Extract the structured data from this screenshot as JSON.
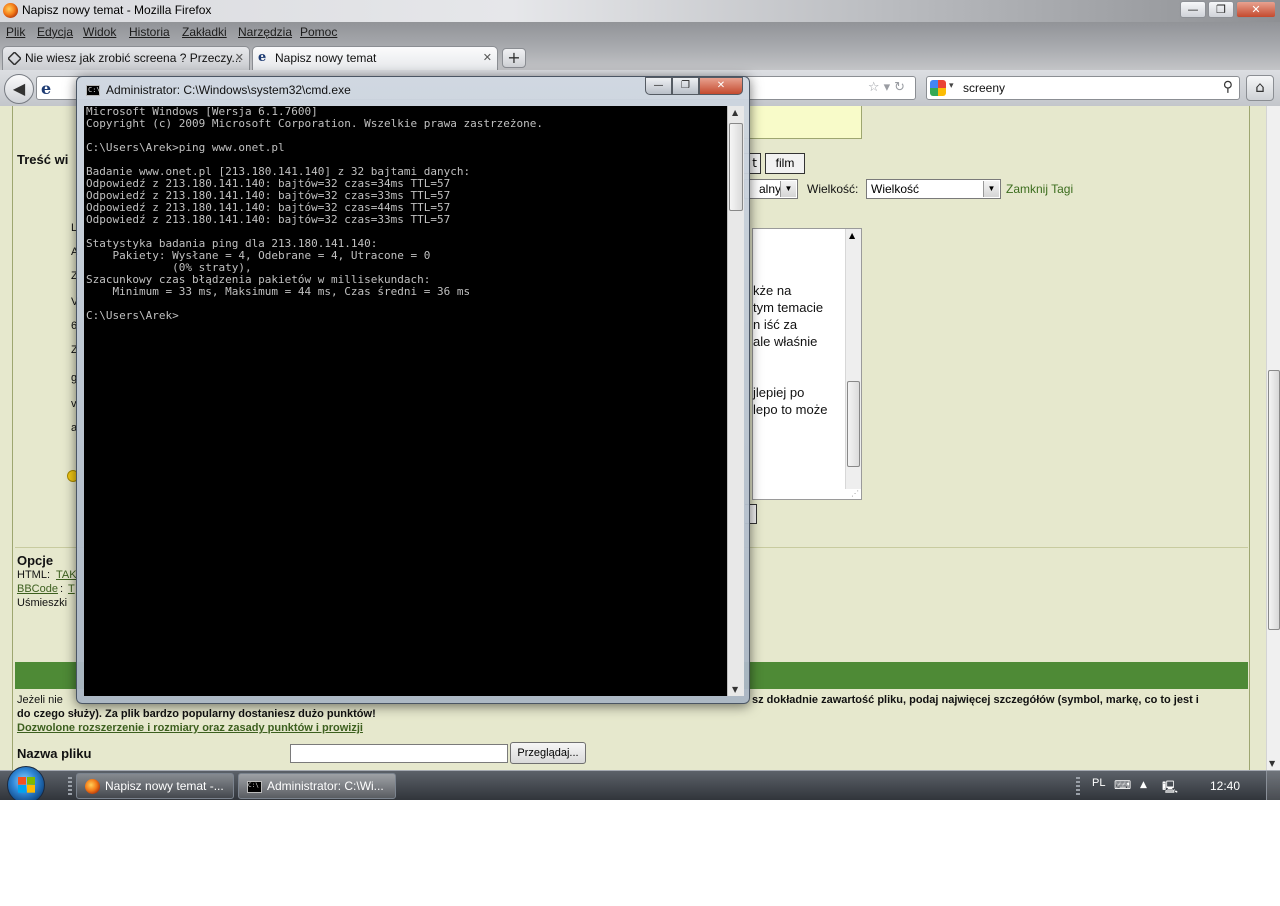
{
  "firefox": {
    "window_title": "Napisz nowy temat - Mozilla Firefox",
    "menu": [
      "Plik",
      "Edycja",
      "Widok",
      "Historia",
      "Zakładki",
      "Narzędzia",
      "Pomoc"
    ],
    "tabs": [
      {
        "label": "Nie wiesz jak zrobić screena ? Przeczy...",
        "active": false
      },
      {
        "label": "Napisz nowy temat",
        "active": true
      }
    ],
    "window_buttons": {
      "minimize": "—",
      "maximize": "❐",
      "close": "✕"
    }
  },
  "search": {
    "value": "screeny"
  },
  "page": {
    "content_heading_partial": "Treść wi",
    "film_button": "film",
    "prev_button_partial": "t",
    "style_select_partial": "alny",
    "size_label": "Wielkość:",
    "size_select_value": "Wielkość",
    "close_tags_link": "Zamknij Tagi",
    "editor_lines": [
      "kże na",
      "tym temacie",
      "n iść za",
      "ale właśnie",
      "",
      "",
      "jlepiej po",
      "lepo to może"
    ],
    "left_column_fragments": [
      "L",
      "A",
      "Z",
      "V",
      "6",
      "Z",
      "g",
      "v",
      "a"
    ],
    "options_heading": "Opcje",
    "html_label": "HTML:",
    "html_value": "TAK",
    "bbcode_label": "BBCode",
    "bbcode_value": "T",
    "smilies_label": "Uśmieszki",
    "attachment_text_start": "Jeżeli nie",
    "attachment_text_end": "sz dokładnie zawartość pliku, podaj najwięcej szczegółów (symbol, markę, co to jest i",
    "attachment_text_line2": "do czego służy). Za plik bardzo popularny dostaniesz dużo punktów!",
    "attachment_rules_link": "Dozwolone rozszerzenie i rozmiary oraz zasady punktów i prowizji",
    "file_name_label": "Nazwa pliku",
    "browse_button": "Przeglądaj..."
  },
  "cmd": {
    "title": "Administrator: C:\\Windows\\system32\\cmd.exe",
    "lines": [
      "Microsoft Windows [Wersja 6.1.7600]",
      "Copyright (c) 2009 Microsoft Corporation. Wszelkie prawa zastrzeżone.",
      "",
      "C:\\Users\\Arek>ping www.onet.pl",
      "",
      "Badanie www.onet.pl [213.180.141.140] z 32 bajtami danych:",
      "Odpowiedź z 213.180.141.140: bajtów=32 czas=34ms TTL=57",
      "Odpowiedź z 213.180.141.140: bajtów=32 czas=33ms TTL=57",
      "Odpowiedź z 213.180.141.140: bajtów=32 czas=44ms TTL=57",
      "Odpowiedź z 213.180.141.140: bajtów=32 czas=33ms TTL=57",
      "",
      "Statystyka badania ping dla 213.180.141.140:",
      "    Pakiety: Wysłane = 4, Odebrane = 4, Utracone = 0",
      "             (0% straty),",
      "Szacunkowy czas błądzenia pakietów w millisekundach:",
      "    Minimum = 33 ms, Maksimum = 44 ms, Czas średni = 36 ms",
      "",
      "C:\\Users\\Arek>"
    ]
  },
  "taskbar": {
    "items": [
      {
        "label": "Napisz nowy temat -...",
        "icon": "firefox-icon",
        "active": false
      },
      {
        "label": "Administrator: C:\\Wi...",
        "icon": "cmd-icon",
        "active": true
      }
    ],
    "language": "PL",
    "clock": "12:40"
  }
}
